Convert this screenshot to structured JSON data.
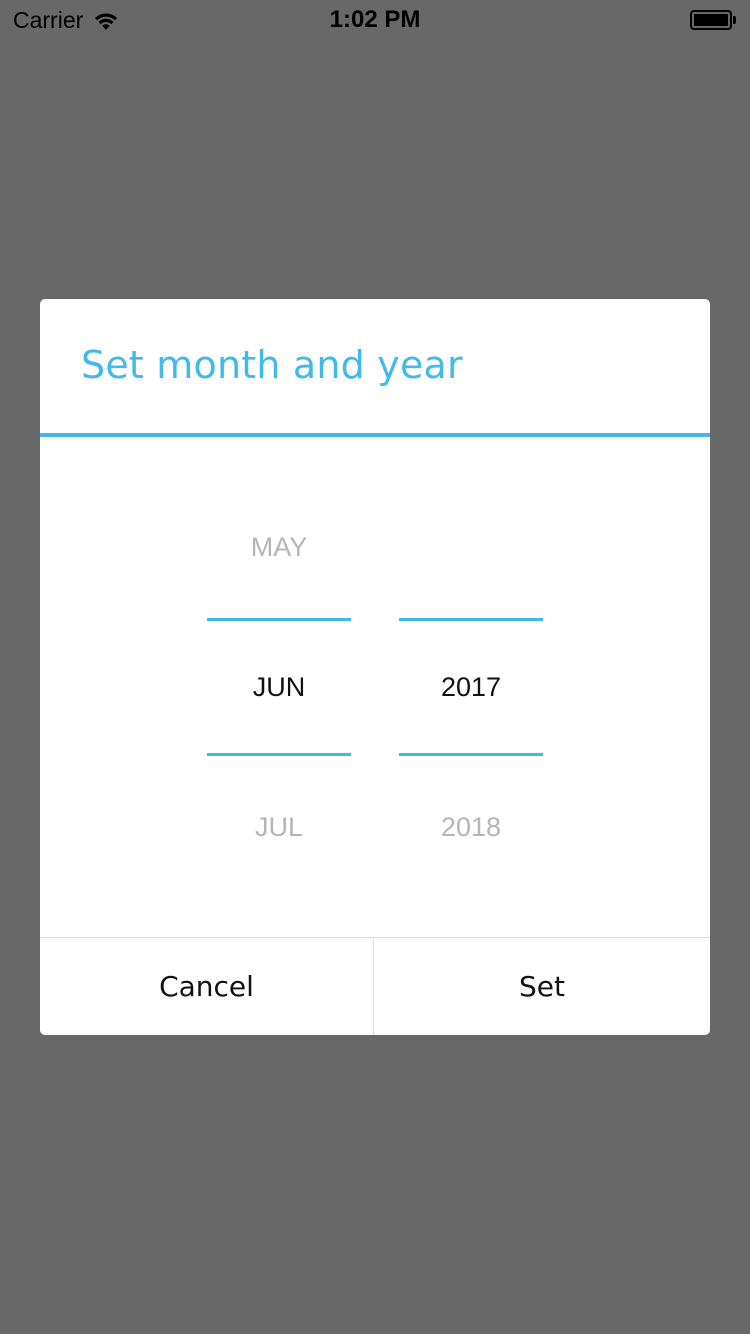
{
  "status_bar": {
    "carrier": "Carrier",
    "time": "1:02 PM",
    "wifi_icon": "wifi-icon",
    "battery_icon": "battery-icon",
    "battery_level": 1.0
  },
  "dialog": {
    "title": "Set month and year",
    "accent_color": "#41b9ea",
    "month_picker": {
      "prev": "MAY",
      "selected": "JUN",
      "next": "JUL"
    },
    "year_picker": {
      "prev": "",
      "selected": "2017",
      "next": "2018"
    },
    "buttons": {
      "cancel_label": "Cancel",
      "set_label": "Set"
    }
  },
  "colors": {
    "overlay": "#686868",
    "accent": "#41b9ea",
    "faded_text": "#b5b5b5"
  }
}
